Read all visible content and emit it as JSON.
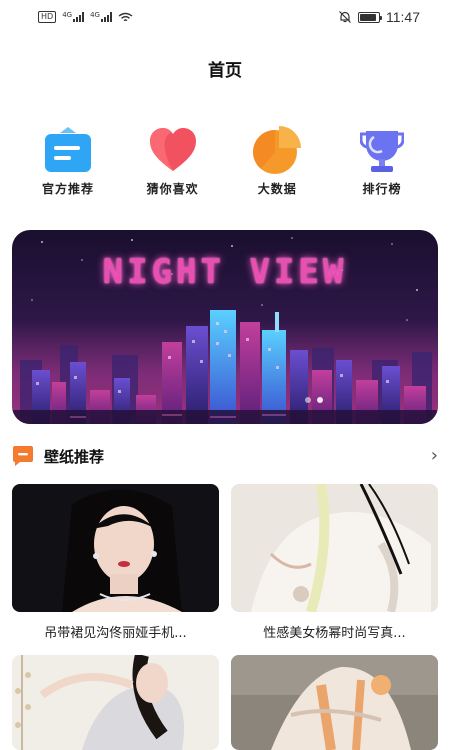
{
  "status_bar": {
    "sim1_net": "4G",
    "sim2_net": "4G",
    "time": "11:47",
    "battery_level": 0.9
  },
  "header": {
    "title": "首页"
  },
  "quick_nav": [
    {
      "label": "官方推荐",
      "icon": "recommend-icon",
      "color": "#2ea6f5"
    },
    {
      "label": "猜你喜欢",
      "icon": "heart-icon",
      "color": "#f2525f"
    },
    {
      "label": "大数据",
      "icon": "pie-chart-icon",
      "color": "#f59a2a"
    },
    {
      "label": "排行榜",
      "icon": "trophy-icon",
      "color": "#6c73f0"
    }
  ],
  "banner": {
    "title": "NIGHT VIEW"
  },
  "section": {
    "title": "壁纸推荐",
    "icon": "chat-bubble-icon",
    "color": "#f37a2f"
  },
  "wallpapers": [
    {
      "caption": "吊带裙见沟佟丽娅手机..."
    },
    {
      "caption": "性感美女杨幂时尚写真..."
    },
    {
      "caption": ""
    },
    {
      "caption": ""
    }
  ]
}
